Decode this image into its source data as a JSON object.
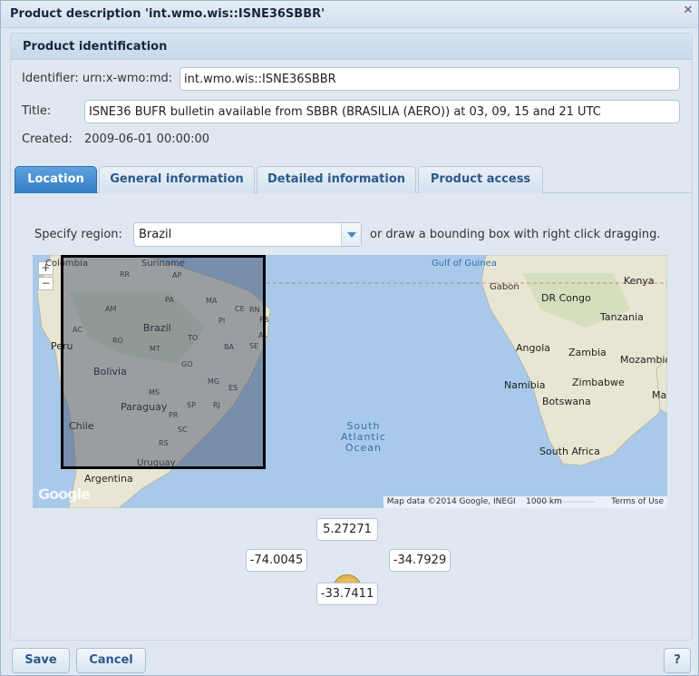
{
  "window": {
    "title": "Product description 'int.wmo.wis::ISNE36SBBR'"
  },
  "section": {
    "title": "Product identification"
  },
  "identifier": {
    "label": "Identifier: urn:x-wmo:md:",
    "value": "int.wmo.wis::ISNE36SBBR"
  },
  "title_field": {
    "label": "Title:",
    "value": "ISNE36 BUFR bulletin available from SBBR (BRASILIA (AERO)) at 03, 09, 15 and 21 UTC"
  },
  "created": {
    "label": "Created:",
    "value": "2009-06-01 00:00:00"
  },
  "tabs": [
    {
      "label": "Location",
      "active": true
    },
    {
      "label": "General information",
      "active": false
    },
    {
      "label": "Detailed information",
      "active": false
    },
    {
      "label": "Product access",
      "active": false
    }
  ],
  "region": {
    "label": "Specify region:",
    "selected": "Brazil",
    "hint": "or draw a bounding box with right click dragging."
  },
  "map": {
    "zoom_in": "+",
    "zoom_out": "−",
    "logo": "Google",
    "attribution": "Map data ©2014 Google, INEGI",
    "scale": "1000 km",
    "terms": "Terms of Use",
    "labels": {
      "colombia": "Colombia",
      "suriname": "Suriname",
      "brazil": "Brazil",
      "peru": "Peru",
      "bolivia": "Bolivia",
      "paraguay": "Paraguay",
      "chile": "Chile",
      "argentina": "Argentina",
      "uruguay": "Uruguay",
      "gulf": "Gulf of Guinea",
      "ocean": "South\nAtlantic\nOcean",
      "gabon": "Gabon",
      "drcongo": "DR Congo",
      "kenya": "Kenya",
      "tanzania": "Tanzania",
      "angola": "Angola",
      "zambia": "Zambia",
      "mozambique": "Mozambiq",
      "namibia": "Namibia",
      "zimbabwe": "Zimbabwe",
      "botswana": "Botswana",
      "southafrica": "South Africa",
      "madagascar": "Mad"
    },
    "states": [
      "RR",
      "AP",
      "AM",
      "PA",
      "MA",
      "CE",
      "RN",
      "PB",
      "PI",
      "AC",
      "RO",
      "TO",
      "AL",
      "SE",
      "MT",
      "BA",
      "GO",
      "MG",
      "MS",
      "ES",
      "SP",
      "RJ",
      "PR",
      "SC",
      "RS"
    ]
  },
  "bbox": {
    "north": "5.27271",
    "west": "-74.0045",
    "east": "-34.7929",
    "south": "-33.7411"
  },
  "buttons": {
    "save": "Save",
    "cancel": "Cancel",
    "help": "?"
  },
  "colors": {
    "accent": "#2f7bc3",
    "ocean": "#a8c9ea",
    "land": "#e8e6d3"
  }
}
